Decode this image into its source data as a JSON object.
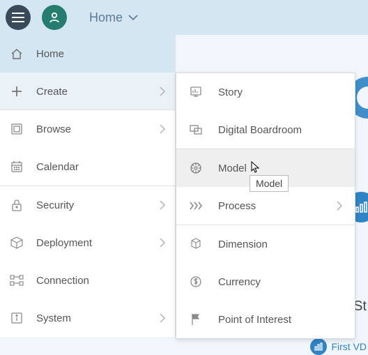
{
  "topbar": {
    "breadcrumb_label": "Home"
  },
  "sidebar": {
    "items": [
      {
        "label": "Home",
        "icon": "home-icon",
        "has_submenu": false
      },
      {
        "label": "Create",
        "icon": "plus-icon",
        "has_submenu": true
      },
      {
        "label": "Browse",
        "icon": "browse-icon",
        "has_submenu": true
      },
      {
        "label": "Calendar",
        "icon": "calendar-icon",
        "has_submenu": false
      },
      {
        "label": "Security",
        "icon": "lock-icon",
        "has_submenu": true
      },
      {
        "label": "Deployment",
        "icon": "box-icon",
        "has_submenu": true
      },
      {
        "label": "Connection",
        "icon": "connection-icon",
        "has_submenu": false
      },
      {
        "label": "System",
        "icon": "info-icon",
        "has_submenu": true
      }
    ]
  },
  "submenu": {
    "items": [
      {
        "label": "Story",
        "icon": "story-icon"
      },
      {
        "label": "Digital Boardroom",
        "icon": "boardroom-icon"
      },
      {
        "label": "Model",
        "icon": "model-icon",
        "hovered": true
      },
      {
        "label": "Process",
        "icon": "process-icon",
        "has_submenu": true
      },
      {
        "label": "Dimension",
        "icon": "dimension-icon"
      },
      {
        "label": "Currency",
        "icon": "currency-icon"
      },
      {
        "label": "Point of Interest",
        "icon": "flag-icon"
      }
    ]
  },
  "tooltip": {
    "text": "Model"
  },
  "background": {
    "right_truncated_heading": "St",
    "right_link_label": "First VD"
  },
  "colors": {
    "brand_primary": "#2e84c4",
    "topbar_bg": "#d4e6f2",
    "hamburger_bg": "#3a4a5a",
    "user_bg": "#247d6f",
    "submenu_hover": "#efefef"
  }
}
